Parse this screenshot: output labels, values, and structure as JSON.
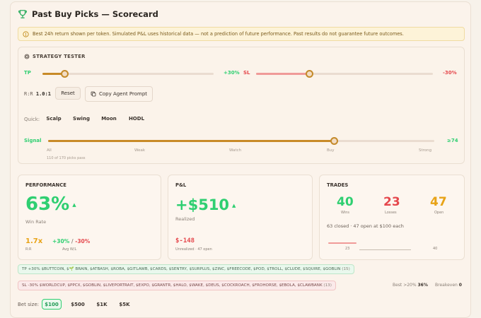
{
  "header": {
    "title": "Past Buy Picks — Scorecard"
  },
  "warning": {
    "text": "Best 24h return shown per token. Simulated P&L uses historical data — not a prediction of future performance. Past results do not guarantee future outcomes."
  },
  "tester": {
    "title": "STRATEGY TESTER",
    "tp": {
      "label": "TP",
      "value": "+30%",
      "fraction": 0.13
    },
    "sl": {
      "label": "SL",
      "value": "-30%",
      "fraction": 0.3
    },
    "rr_label": "R:R",
    "rr_value": "1.0:1",
    "reset_label": "Reset",
    "copy_label": "Copy Agent Prompt",
    "quick_label": "Quick:",
    "quick": [
      "Scalp",
      "Swing",
      "Moon",
      "HODL"
    ],
    "signal": {
      "label": "Signal",
      "value": "≥74",
      "fraction": 0.74
    },
    "ticks": [
      "All",
      "Weak",
      "Watch",
      "Buy",
      "Strong"
    ],
    "passed": "110 of 170 picks pass"
  },
  "performance": {
    "title": "PERFORMANCE",
    "value": "63%",
    "value_label": "Win Rate",
    "rr": "1.7x",
    "rr_label": "R:R",
    "tp": "+30%",
    "sl": "-30%",
    "avg_label": "Avg W/L"
  },
  "pnl": {
    "title": "P&L",
    "value": "+$510",
    "label": "Realized",
    "unrealized": "$-148",
    "unrealized_label": "Unrealized · 47 open"
  },
  "trades": {
    "title": "TRADES",
    "wins": "40",
    "wins_label": "Wins",
    "losses": "23",
    "losses_label": "Losses",
    "open": "47",
    "open_label": "Open",
    "summary": "63 closed · 47 open at $100 each",
    "bar_left": "23",
    "bar_right": "40",
    "loss_fraction": 0.37,
    "win_fraction": 0.63
  },
  "tags": {
    "tp_text": "TP +30%  $BUTTCOIN, $🌱 BRAIN, $ATBASH, $ROBA, $GITLAWB, $CARDS, $SENTRY, $SURPLUS, $ZINC, $FREECODE, $POD, $TROLL, $CLUDE, $SQUIRE, $GOBLIN",
    "tp_count": "(15)",
    "sl_text": "SL -30%  $WORLDCUP, $PPCX, $GOBLIN, $LIVEPORTRAIT, $EXPO, $GRANTR, $HALO, $WAKE, $DEUS, $COCKROACH, $FROHORSE, $EBOLA, $CLAWBANK",
    "sl_count": "(13)",
    "best_label": "Best >20%",
    "best_value": "36%",
    "breakeven_label": "Breakeven",
    "breakeven_value": "0"
  },
  "bet": {
    "label": "Bet size:",
    "options": [
      "$100",
      "$500",
      "$1K",
      "$5K"
    ],
    "selected": "$100"
  },
  "colors": {
    "green": "#2fcf71",
    "red": "#e5484d",
    "amber": "#e8a317",
    "track_fill": "#c88a28"
  }
}
